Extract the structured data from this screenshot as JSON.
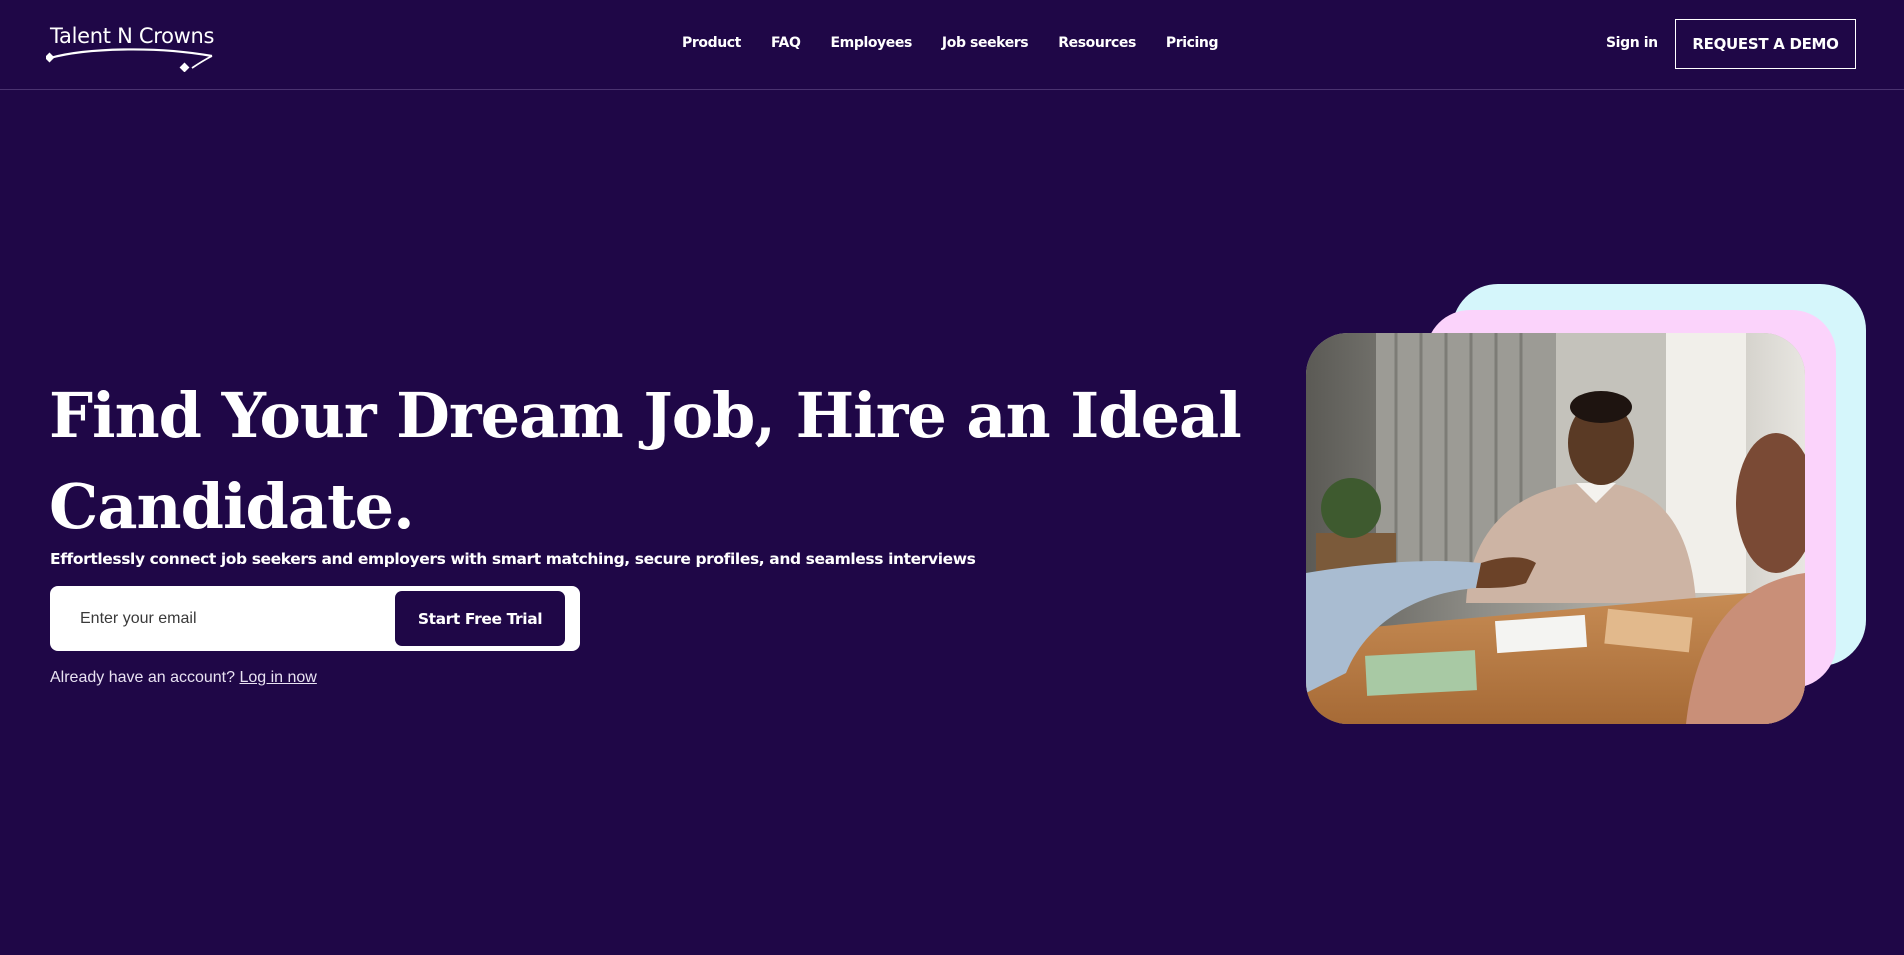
{
  "header": {
    "logo_text": "Talent N Crowns",
    "nav": [
      "Product",
      "FAQ",
      "Employees",
      "Job seekers",
      "Resources",
      "Pricing"
    ],
    "signin": "Sign in",
    "demo": "REQUEST A DEMO"
  },
  "hero": {
    "headline": "Find Your Dream Job, Hire an Ideal Candidate.",
    "subtext": "Effortlessly connect job seekers and employers with smart matching, secure profiles, and seamless interviews",
    "email_placeholder": "Enter your email",
    "cta": "Start Free Trial",
    "account_prompt": "Already have an account?",
    "login_link": "Log in now"
  },
  "colors": {
    "background": "#1f0747",
    "card_back": "#d5f6fb",
    "card_mid": "#fbd3fb"
  },
  "icons": [
    "crown-swoosh-icon"
  ]
}
